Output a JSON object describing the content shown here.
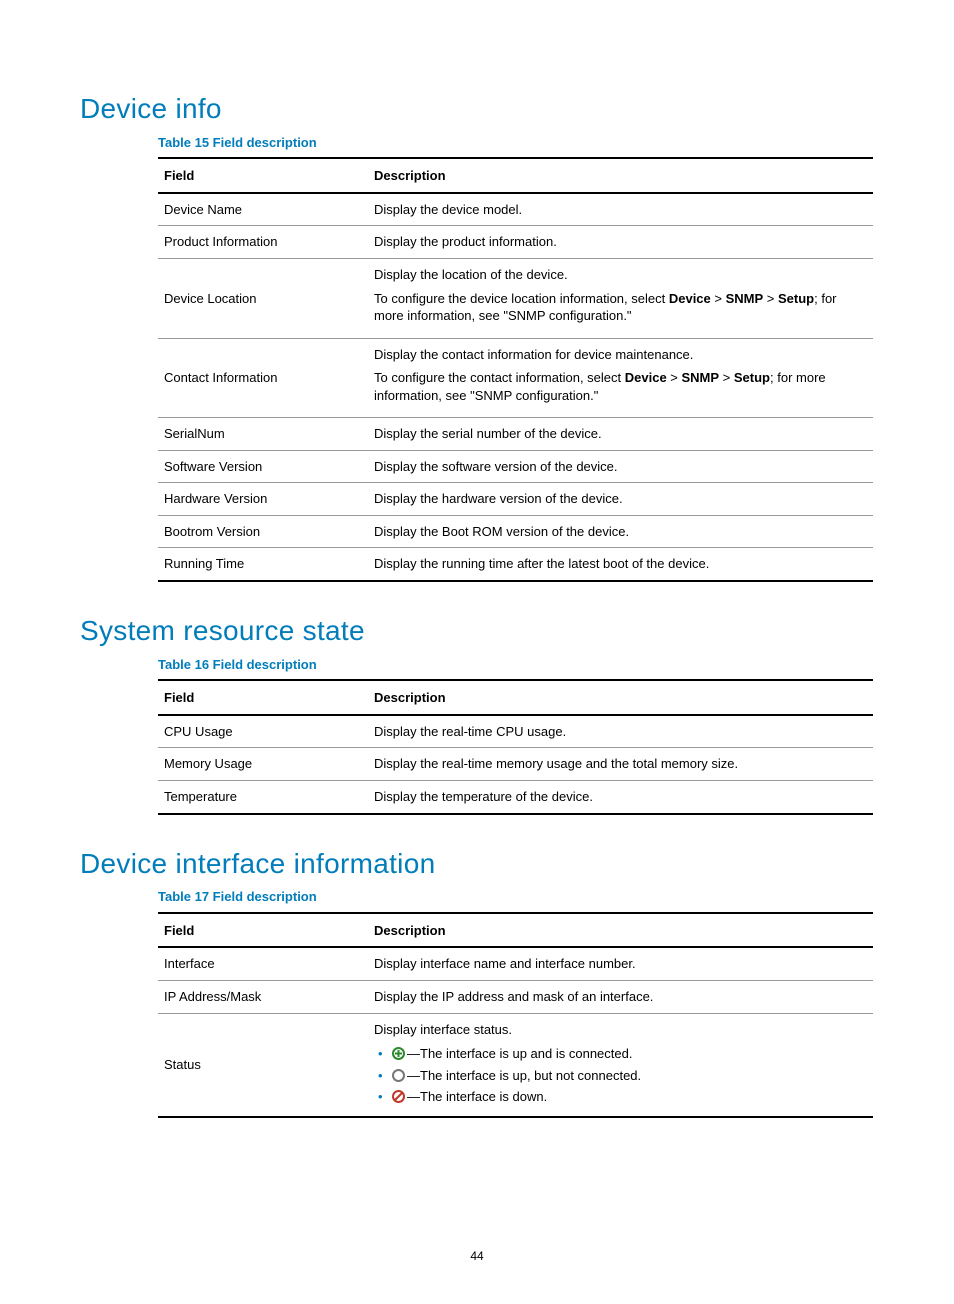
{
  "sections": [
    {
      "title": "Device info",
      "caption": "Table 15 Field description",
      "headers": {
        "field": "Field",
        "desc": "Description"
      }
    },
    {
      "title": "System resource state",
      "caption": "Table 16 Field description",
      "headers": {
        "field": "Field",
        "desc": "Description"
      }
    },
    {
      "title": "Device interface information",
      "caption": "Table 17 Field description",
      "headers": {
        "field": "Field",
        "desc": "Description"
      }
    }
  ],
  "t15": {
    "r0": {
      "field": "Device Name",
      "desc": "Display the device model."
    },
    "r1": {
      "field": "Product Information",
      "desc": "Display the product information."
    },
    "r2": {
      "field": "Device Location",
      "p1": "Display the location of the device.",
      "p2a": "To configure the device location information, select ",
      "p2b1": "Device",
      "p2gt": " > ",
      "p2b2": "SNMP",
      "p2b3": "Setup",
      "p2c": "; for more information, see \"SNMP configuration.\""
    },
    "r3": {
      "field": "Contact Information",
      "p1": "Display the contact information for device maintenance.",
      "p2a": "To configure the contact information, select ",
      "p2b1": "Device",
      "p2gt": " > ",
      "p2b2": "SNMP",
      "p2b3": "Setup",
      "p2c": "; for more information, see \"SNMP configuration.\""
    },
    "r4": {
      "field": "SerialNum",
      "desc": "Display the serial number of the device."
    },
    "r5": {
      "field": "Software Version",
      "desc": "Display the software version of the device."
    },
    "r6": {
      "field": "Hardware Version",
      "desc": "Display the hardware version of the device."
    },
    "r7": {
      "field": "Bootrom Version",
      "desc": "Display the Boot ROM version of the device."
    },
    "r8": {
      "field": "Running Time",
      "desc": "Display the running time after the latest boot of the device."
    }
  },
  "t16": {
    "r0": {
      "field": "CPU Usage",
      "desc": "Display the real-time CPU usage."
    },
    "r1": {
      "field": "Memory Usage",
      "desc": "Display the real-time memory usage and the total memory size."
    },
    "r2": {
      "field": "Temperature",
      "desc": "Display the temperature of the device."
    }
  },
  "t17": {
    "r0": {
      "field": "Interface",
      "desc": "Display interface name and interface number."
    },
    "r1": {
      "field": "IP Address/Mask",
      "desc": "Display the IP address and mask of an interface."
    },
    "r2": {
      "field": "Status",
      "p1": "Display interface status.",
      "b1": "—The interface is up and is connected.",
      "b2": "—The interface is up, but not connected.",
      "b3": "—The interface is down."
    }
  },
  "page": "44"
}
